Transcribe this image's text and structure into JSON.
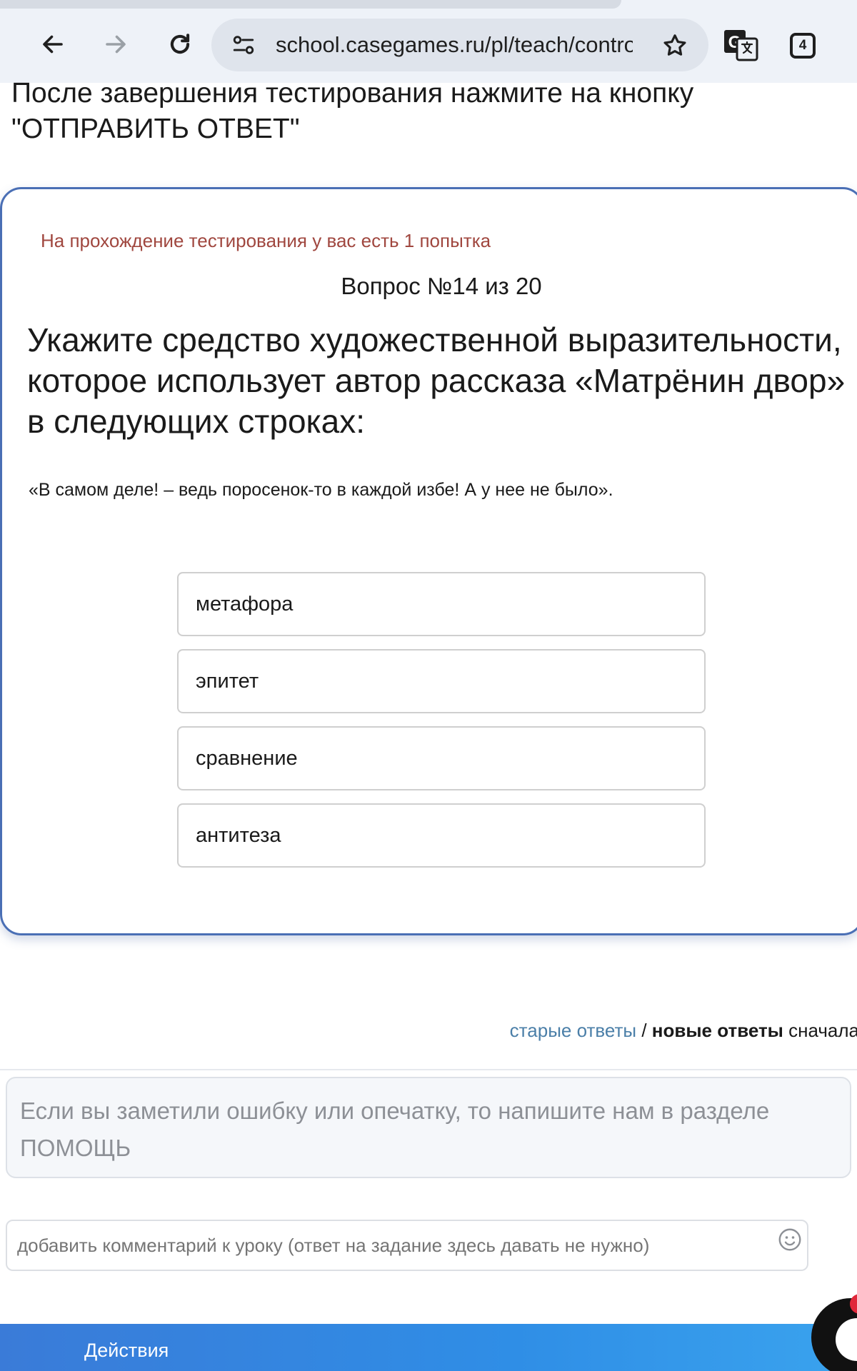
{
  "browser": {
    "url": "school.casegames.ru/pl/teach/control",
    "tab_count": "4"
  },
  "page": {
    "instruction": "После завершения тестирования нажмите на кнопку \"ОТПРАВИТЬ ОТВЕТ\""
  },
  "test": {
    "attempts_notice": "На прохождение тестирования у вас есть 1 попытка",
    "question_number": "Вопрос №14 из 20",
    "question_text": "Укажите средство художественной выразительности, которое использует автор рассказа «Матрёнин двор» в следующих строках:",
    "quote": "«В самом деле! – ведь поросенок-то в каждой избе! А у нее не было».",
    "options": [
      "метафора",
      "эпитет",
      "сравнение",
      "антитеза"
    ]
  },
  "answers_sort": {
    "old": "старые ответы",
    "separator": " / ",
    "new": "новые ответы",
    "suffix": " сначала"
  },
  "notice": "Если вы заметили ошибку или опечатку, то напишите нам в разделе ПОМОЩЬ",
  "comment": {
    "placeholder": "добавить комментарий к уроку (ответ на задание здесь давать не нужно)"
  },
  "bottom_bar": {
    "actions_label": "Действия"
  }
}
